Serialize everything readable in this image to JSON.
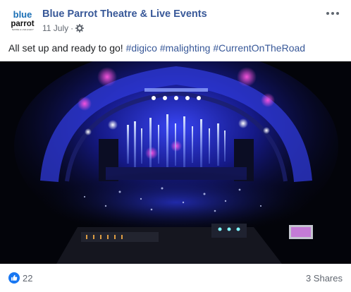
{
  "page": {
    "name": "Blue Parrot Theatre & Live Events",
    "avatar_text_line1": "blue",
    "avatar_text_line2": "parrot",
    "avatar_text_line3": "THEATRE & LIVE EVENTS"
  },
  "post": {
    "date": "11 July",
    "separator": "·",
    "privacy_icon": "gear-icon",
    "text": "All set up and ready to go!",
    "hashtags": [
      "#digico",
      "#malighting",
      "#CurrentOnTheRoad"
    ]
  },
  "footer": {
    "reaction_icon": "like-icon",
    "like_count": "22",
    "shares": "3 Shares"
  },
  "colors": {
    "link": "#385898",
    "meta": "#616770",
    "like_blue": "#1877f2",
    "stage_blue": "#2a3fff",
    "stage_magenta": "#ff3fd0"
  }
}
